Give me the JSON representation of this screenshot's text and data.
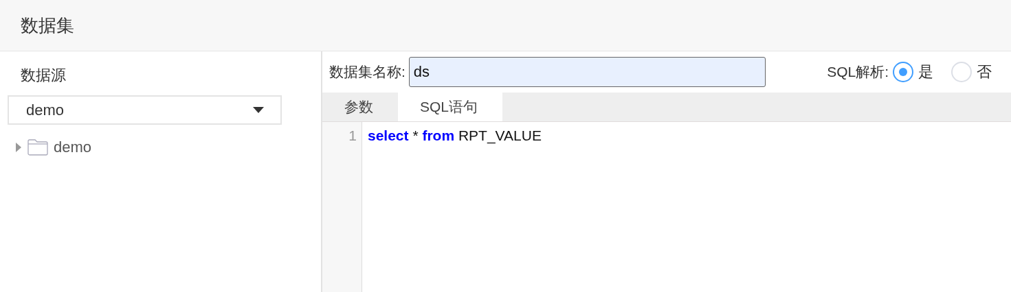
{
  "header": {
    "title": "数据集"
  },
  "sidebar": {
    "label": "数据源",
    "datasource_select": {
      "value": "demo"
    },
    "tree": [
      {
        "label": "demo",
        "expanded": false
      }
    ]
  },
  "form": {
    "name_label": "数据集名称:",
    "name_value": "ds",
    "sql_parse_label": "SQL解析:",
    "sql_parse_options": [
      {
        "label": "是",
        "selected": true
      },
      {
        "label": "否",
        "selected": false
      }
    ]
  },
  "tabs": [
    {
      "label": "参数",
      "selected": false
    },
    {
      "label": "SQL语句",
      "selected": true
    }
  ],
  "editor": {
    "lines": [
      {
        "number": "1",
        "tokens": [
          {
            "text": "select",
            "kind": "keyword"
          },
          {
            "text": " * ",
            "kind": "plain"
          },
          {
            "text": "from",
            "kind": "keyword"
          },
          {
            "text": " RPT_VALUE",
            "kind": "plain"
          }
        ]
      }
    ]
  }
}
